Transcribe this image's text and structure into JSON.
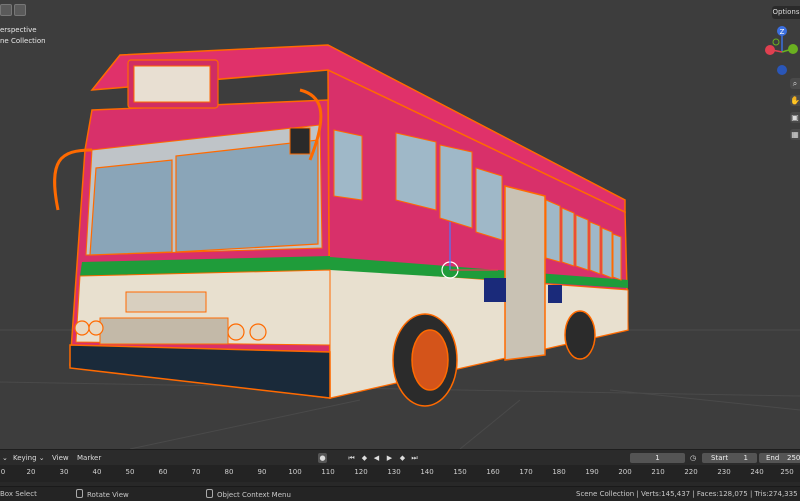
{
  "viewport": {
    "view_name": "erspective",
    "collection_name": "ne Collection",
    "options_label": "Options",
    "gizmo_axes": [
      "Z",
      "X",
      "Y"
    ],
    "tool_icons": [
      "zoom-icon",
      "hand-icon",
      "camera-icon",
      "grid-icon"
    ],
    "colors": {
      "background": "#3d3d3d",
      "selection": "#ff6a00",
      "bus_body": "#e0316a",
      "bus_cream": "#eee8d8",
      "stripe": "#1f9c3a"
    }
  },
  "timeline": {
    "keying_label": "Keying",
    "view_label": "View",
    "marker_label": "Marker",
    "current_frame": "1",
    "start_label": "Start",
    "start_value": "1",
    "end_label": "End",
    "end_value": "250",
    "ruler_ticks": [
      "0",
      "20",
      "30",
      "40",
      "50",
      "60",
      "70",
      "80",
      "90",
      "100",
      "110",
      "120",
      "130",
      "140",
      "150",
      "160",
      "170",
      "180",
      "190",
      "200",
      "210",
      "220",
      "230",
      "240",
      "250"
    ]
  },
  "status_bar": {
    "box_select": "Box Select",
    "rotate_view": "Rotate View",
    "context_menu": "Object Context Menu",
    "stats": "Scene Collection | Verts:145,437 | Faces:128,075 | Tris:274,335 | Obje"
  }
}
